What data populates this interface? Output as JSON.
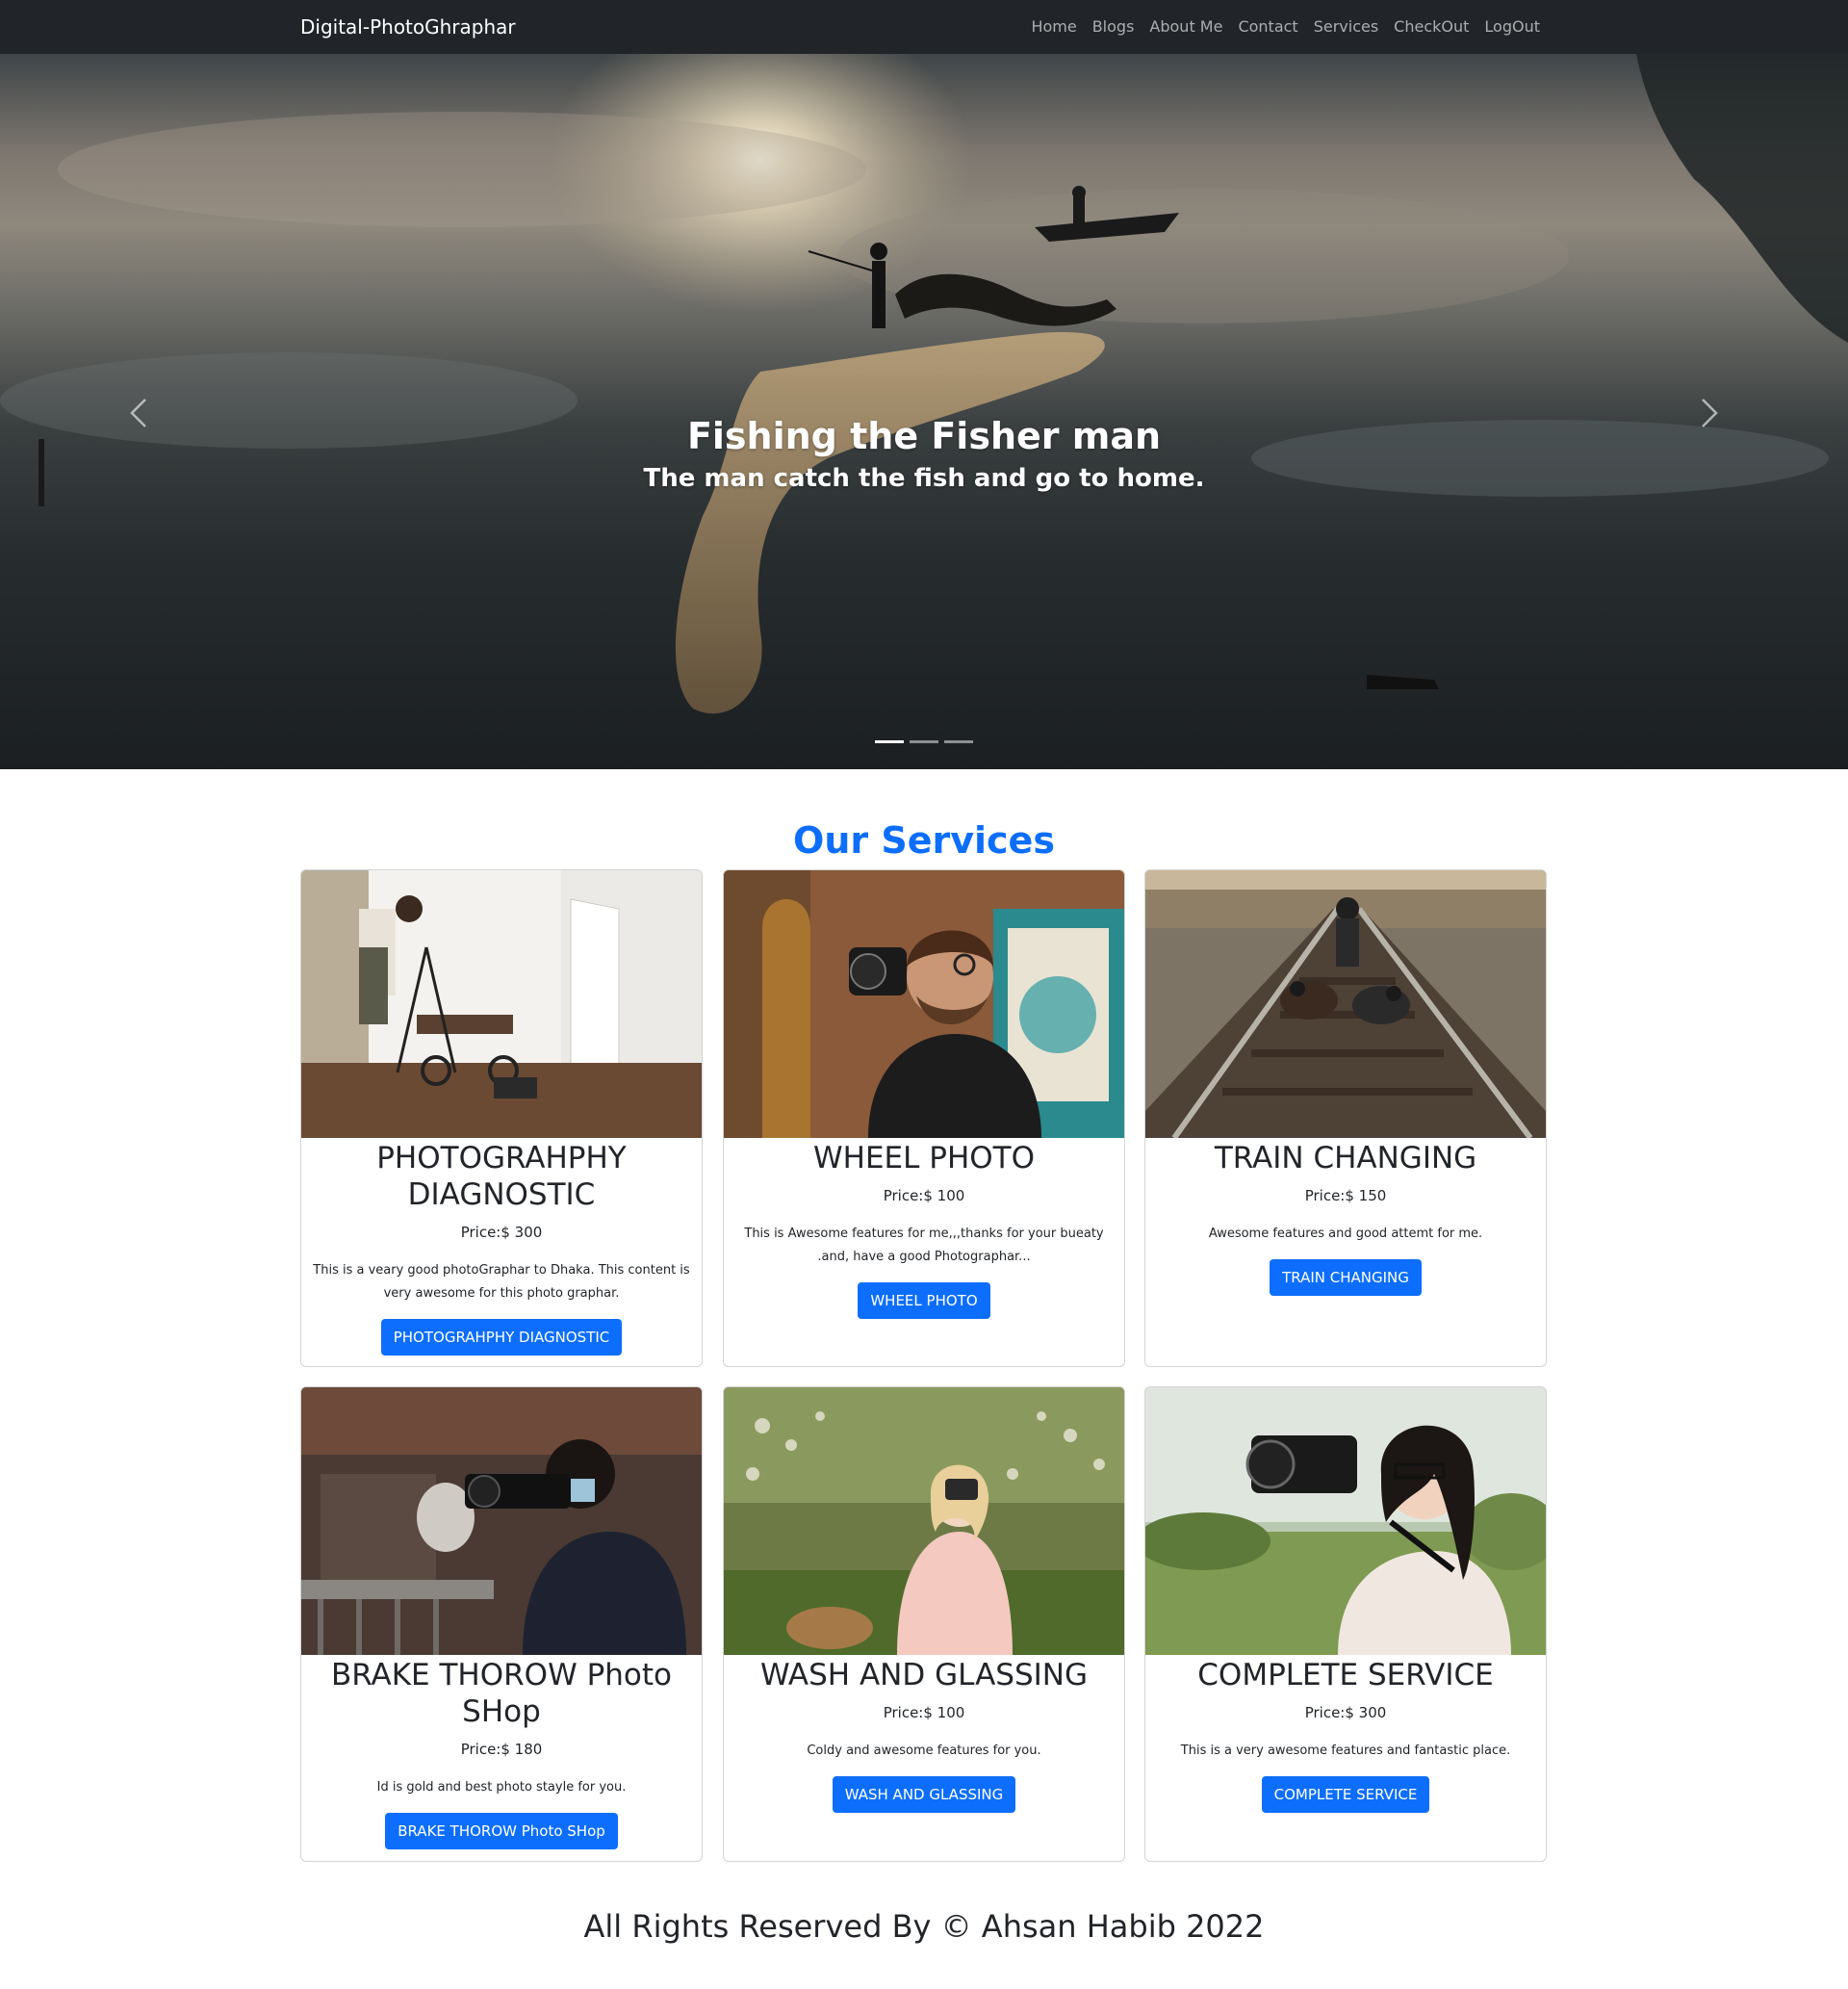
{
  "navbar": {
    "brand": "Digital-PhotoGhraphar",
    "links": [
      "Home",
      "Blogs",
      "About Me",
      "Contact",
      "Services",
      "CheckOut",
      "LogOut"
    ]
  },
  "carousel": {
    "caption_title": "Fishing the Fisher man",
    "caption_text": "The man catch the fish and go to home.",
    "slides_count": 3,
    "active_slide": 1,
    "prev_icon": "chevron-left-icon",
    "next_icon": "chevron-right-icon"
  },
  "services": {
    "heading": "Our Services",
    "cards": [
      {
        "title": "PHOTOGRAHPHY DIAGNOSTIC",
        "price": "Price:$ 300",
        "description": "This is a veary good photoGraphar to Dhaka. This content is very awesome for this photo graphar.",
        "button": "PHOTOGRAHPHY DIAGNOSTIC"
      },
      {
        "title": "WHEEL PHOTO",
        "price": "Price:$ 100",
        "description": "This is Awesome features for me,,,thanks for your bueaty .and, have a good Photographar...",
        "button": "WHEEL PHOTO"
      },
      {
        "title": "TRAIN CHANGING",
        "price": "Price:$ 150",
        "description": "Awesome features and good attemt for me.",
        "button": "TRAIN CHANGING"
      },
      {
        "title": "BRAKE THOROW Photo SHop",
        "price": "Price:$ 180",
        "description": "Id is gold and best photo stayle for you.",
        "button": "BRAKE THOROW Photo SHop"
      },
      {
        "title": "WASH AND GLASSING",
        "price": "Price:$ 100",
        "description": "Coldy and awesome features for you.",
        "button": "WASH AND GLASSING"
      },
      {
        "title": "COMPLETE SERVICE",
        "price": "Price:$ 300",
        "description": "This is a very awesome features and fantastic place.",
        "button": "COMPLETE SERVICE"
      }
    ]
  },
  "footer": {
    "text": "All Rights Reserved By © Ahsan Habib 2022"
  },
  "colors": {
    "navbar_bg": "#212529",
    "primary": "#0d6efd",
    "text": "#212529"
  }
}
